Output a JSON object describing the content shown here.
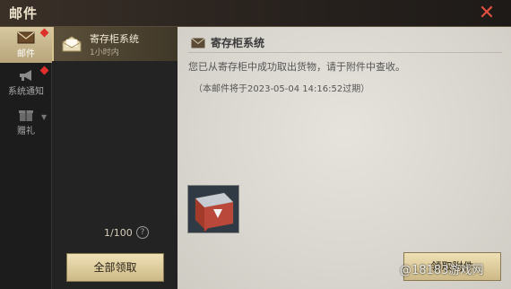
{
  "window": {
    "title": "邮件"
  },
  "categories": [
    {
      "label": "邮件",
      "icon": "envelope-icon",
      "active": true,
      "unread": true
    },
    {
      "label": "系统通知",
      "icon": "megaphone-icon",
      "active": false,
      "unread": true
    },
    {
      "label": "赠礼",
      "icon": "gift-icon",
      "active": false,
      "unread": false
    }
  ],
  "mail_list": {
    "items": [
      {
        "title": "寄存柜系统",
        "time": "1小时内",
        "icon": "mail-open-icon"
      }
    ],
    "count": "1/100",
    "help_glyph": "?",
    "claim_all_label": "全部领取"
  },
  "mail_detail": {
    "title": "寄存柜系统",
    "body": "您已从寄存柜中成功取出货物，请于附件中查收。",
    "expiry": "（本邮件将于2023-05-04 14:16:52过期）",
    "attachment_icon": "supply-crate-icon",
    "claim_label": "领取附件"
  },
  "watermark": "@18183游戏网",
  "colors": {
    "accent": "#d9c68f",
    "close": "#e05040",
    "unread_dot": "#e0302a"
  }
}
